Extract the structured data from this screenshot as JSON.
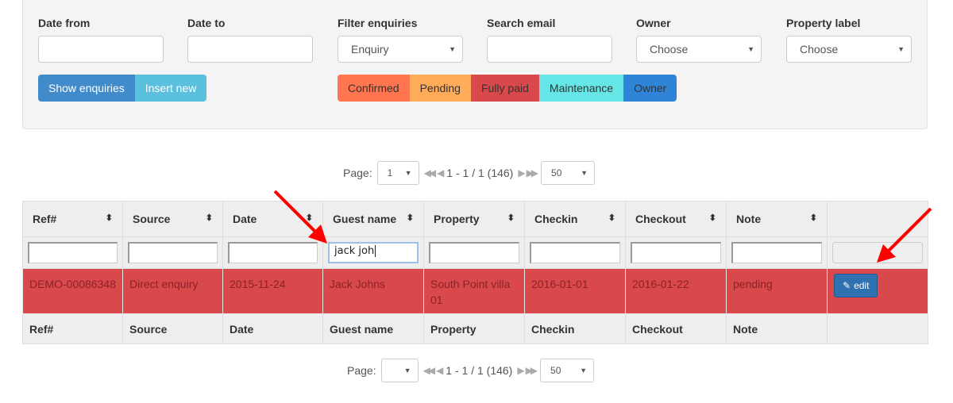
{
  "filters": {
    "date_from": {
      "label": "Date from",
      "value": ""
    },
    "date_to": {
      "label": "Date to",
      "value": ""
    },
    "filter_enquiries": {
      "label": "Filter enquiries",
      "selected": "Enquiry"
    },
    "search_email": {
      "label": "Search email",
      "value": ""
    },
    "owner": {
      "label": "Owner",
      "selected": "Choose"
    },
    "property_label": {
      "label": "Property label",
      "selected": "Choose"
    }
  },
  "actions": {
    "show_enquiries": "Show enquiries",
    "insert_new": "Insert new"
  },
  "legend": [
    {
      "label": "Confirmed",
      "color": "#ff7550"
    },
    {
      "label": "Pending",
      "color": "#ffab58"
    },
    {
      "label": "Fully paid",
      "color": "#d9484a"
    },
    {
      "label": "Maintenance",
      "color": "#66e6e6"
    },
    {
      "label": "Owner",
      "color": "#2f84d8"
    }
  ],
  "pager_top": {
    "label": "Page:",
    "page": "1",
    "info": "1 - 1 / 1 (146)",
    "per_page": "50"
  },
  "pager_bottom": {
    "label": "Page:",
    "page": "",
    "info": "1 - 1 / 1 (146)",
    "per_page": "50"
  },
  "table": {
    "columns": [
      "Ref#",
      "Source",
      "Date",
      "Guest name",
      "Property",
      "Checkin",
      "Checkout",
      "Note"
    ],
    "column_filters": [
      "",
      "",
      "",
      "jack joh",
      "",
      "",
      "",
      ""
    ],
    "rows": [
      {
        "ref": "DEMO-00086348",
        "source": "Direct enquiry",
        "date": "2015-11-24",
        "guest_name": "Jack Johns",
        "property": "South Point villa 01",
        "checkin": "2016-01-01",
        "checkout": "2016-01-22",
        "note": "pending",
        "status_color": "#d9484a",
        "edit_label": "edit"
      }
    ]
  }
}
